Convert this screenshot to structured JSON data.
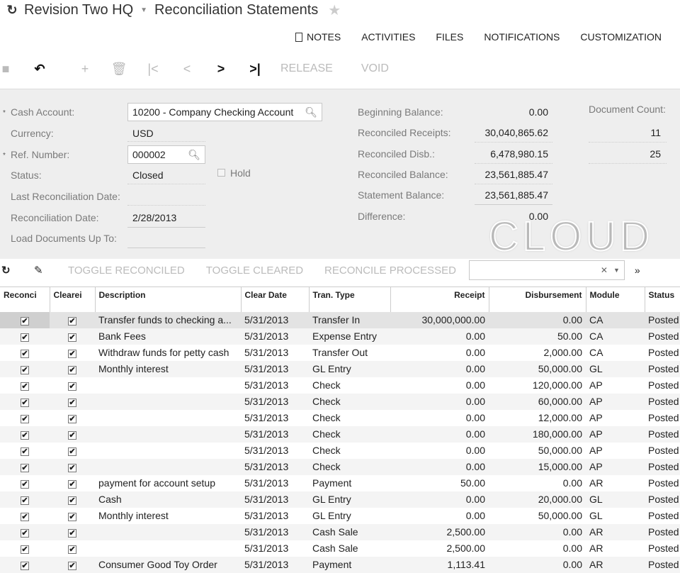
{
  "header": {
    "company": "Revision Two HQ",
    "screen": "Reconciliation Statements"
  },
  "tabs": [
    "NOTES",
    "ACTIVITIES",
    "FILES",
    "NOTIFICATIONS",
    "CUSTOMIZATION"
  ],
  "toolbar": {
    "release": "RELEASE",
    "void": "VOID"
  },
  "form": {
    "cash_account_label": "Cash Account:",
    "cash_account": "10200 - Company Checking Account",
    "currency_label": "Currency:",
    "currency": "USD",
    "ref_label": "Ref. Number:",
    "ref": "000002",
    "status_label": "Status:",
    "status": "Closed",
    "hold_label": "Hold",
    "hold": false,
    "last_rec_label": "Last Reconciliation Date:",
    "last_rec": "",
    "rec_date_label": "Reconciliation Date:",
    "rec_date": "2/28/2013",
    "load_label": "Load Documents Up To:",
    "load": "",
    "beg_label": "Beginning Balance:",
    "beg": "0.00",
    "rr_label": "Reconciled Receipts:",
    "rr": "30,040,865.62",
    "rd_label": "Reconciled Disb.:",
    "rd": "6,478,980.15",
    "rb_label": "Reconciled Balance:",
    "rb": "23,561,885.47",
    "sb_label": "Statement Balance:",
    "sb": "23,561,885.47",
    "diff_label": "Difference:",
    "diff": "0.00",
    "doc_count_label": "Document Count:",
    "doc_count_receipts": "11",
    "doc_count_disb": "25"
  },
  "watermark": "CLOUD",
  "grid_toolbar": {
    "toggle_reconciled": "TOGGLE RECONCILED",
    "toggle_cleared": "TOGGLE CLEARED",
    "reconcile_processed": "RECONCILE PROCESSED",
    "filter": ""
  },
  "columns": [
    "Reconci",
    "Clearei",
    "Description",
    "Clear Date",
    "Tran. Type",
    "Receipt",
    "Disbursement",
    "Module",
    "Status"
  ],
  "rows": [
    [
      "Transfer funds to checking a...",
      "5/31/2013",
      "Transfer In",
      "30,000,000.00",
      "0.00",
      "CA",
      "Posted"
    ],
    [
      "Bank Fees",
      "5/31/2013",
      "Expense Entry",
      "0.00",
      "50.00",
      "CA",
      "Posted"
    ],
    [
      "Withdraw funds for petty cash",
      "5/31/2013",
      "Transfer Out",
      "0.00",
      "2,000.00",
      "CA",
      "Posted"
    ],
    [
      "Monthly interest",
      "5/31/2013",
      "GL Entry",
      "0.00",
      "50,000.00",
      "GL",
      "Posted"
    ],
    [
      "",
      "5/31/2013",
      "Check",
      "0.00",
      "120,000.00",
      "AP",
      "Posted"
    ],
    [
      "",
      "5/31/2013",
      "Check",
      "0.00",
      "60,000.00",
      "AP",
      "Posted"
    ],
    [
      "",
      "5/31/2013",
      "Check",
      "0.00",
      "12,000.00",
      "AP",
      "Posted"
    ],
    [
      "",
      "5/31/2013",
      "Check",
      "0.00",
      "180,000.00",
      "AP",
      "Posted"
    ],
    [
      "",
      "5/31/2013",
      "Check",
      "0.00",
      "50,000.00",
      "AP",
      "Posted"
    ],
    [
      "",
      "5/31/2013",
      "Check",
      "0.00",
      "15,000.00",
      "AP",
      "Posted"
    ],
    [
      "payment for account setup",
      "5/31/2013",
      "Payment",
      "50.00",
      "0.00",
      "AR",
      "Posted"
    ],
    [
      "Cash",
      "5/31/2013",
      "GL Entry",
      "0.00",
      "20,000.00",
      "GL",
      "Posted"
    ],
    [
      "Monthly interest",
      "5/31/2013",
      "GL Entry",
      "0.00",
      "50,000.00",
      "GL",
      "Posted"
    ],
    [
      "",
      "5/31/2013",
      "Cash Sale",
      "2,500.00",
      "0.00",
      "AR",
      "Posted"
    ],
    [
      "",
      "5/31/2013",
      "Cash Sale",
      "2,500.00",
      "0.00",
      "AR",
      "Posted"
    ],
    [
      "Consumer Good Toy Order",
      "5/31/2013",
      "Payment",
      "1,113.41",
      "0.00",
      "AR",
      "Posted"
    ]
  ]
}
